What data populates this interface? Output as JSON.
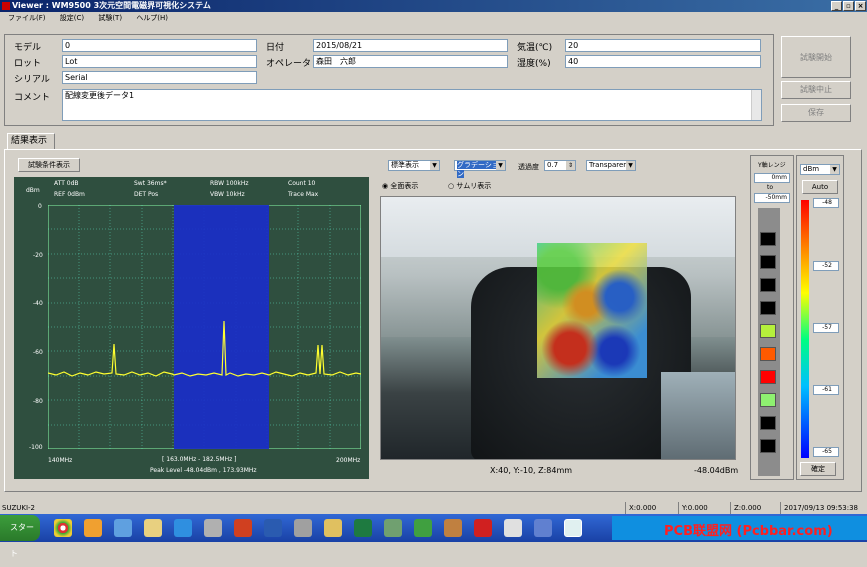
{
  "window": {
    "title": "Viewer : WM9500 3次元空間電磁界可視化システム"
  },
  "menu": [
    "ファイル(F)",
    "設定(C)",
    "試験(T)",
    "ヘルプ(H)"
  ],
  "form": {
    "model_label": "モデル",
    "model_value": "0",
    "lot_label": "ロット",
    "lot_value": "Lot",
    "serial_label": "シリアル",
    "serial_value": "Serial",
    "comment_label": "コメント",
    "comment_value": "配線変更後データ1",
    "date_label": "日付",
    "date_value": "2015/08/21",
    "operator_label": "オペレータ",
    "operator_value": "森田　六郎",
    "temp_label": "気温(℃)",
    "temp_value": "20",
    "humidity_label": "湿度(%)",
    "humidity_value": "40"
  },
  "actions": {
    "start": "試験開始",
    "stop": "試験中止",
    "save": "保存"
  },
  "tab": "結果表示",
  "spectrum": {
    "cond_button": "試験条件表示",
    "att": "ATT  0dB",
    "ref": "REF  0dBm",
    "swt": "Swt  36ms*",
    "det": "DET  Pos",
    "rbw": "RBW  100kHz",
    "vbw": "VBW  10kHz",
    "count": "Count  10",
    "trace": "Trace  Max",
    "unit": "dBm",
    "y_ticks": [
      "0",
      "-20",
      "-40",
      "-60",
      "-80",
      "-100"
    ],
    "x_start": "140MHz",
    "x_end": "200MHz",
    "range_text": "[ 163.0MHz - 182.5MHz ]",
    "peak_text": "Peak Level  -48.04dBm  ,  173.93MHz"
  },
  "view": {
    "mode_combo": "標準表示",
    "colormap_combo": "グラデーション",
    "transparency_label": "透過度",
    "transparency_value": "0.7",
    "blend_combo": "Transparent",
    "radio_all": "全面表示",
    "radio_thumb": "サムリ表示",
    "coord_text": "X:40, Y:-10, Z:84mm",
    "level_text": "-48.04dBm"
  },
  "yrange": {
    "title": "Y軸レンジ",
    "top_value": "0mm",
    "to": "to",
    "bottom_value": "-50mm",
    "swatches": [
      "#000000",
      "#000000",
      "#000000",
      "#000000",
      "#b5f03c",
      "#ff5a00",
      "#ff0000",
      "#8ef070",
      "#000000",
      "#000000"
    ],
    "confirm": "確定"
  },
  "scale": {
    "unit_combo": "dBm",
    "auto": "Auto",
    "labels": [
      "-48",
      "-52",
      "-57",
      "-61",
      "-65"
    ]
  },
  "status": {
    "name": "SUZUKI-2",
    "x": "X:0.000",
    "y": "Y:0.000",
    "z": "Z:0.000",
    "datetime": "2017/09/13 09:53:38"
  },
  "taskbar": {
    "start": "スタート",
    "watermark": "PCB联盟网 (Pcbbar.com)"
  }
}
